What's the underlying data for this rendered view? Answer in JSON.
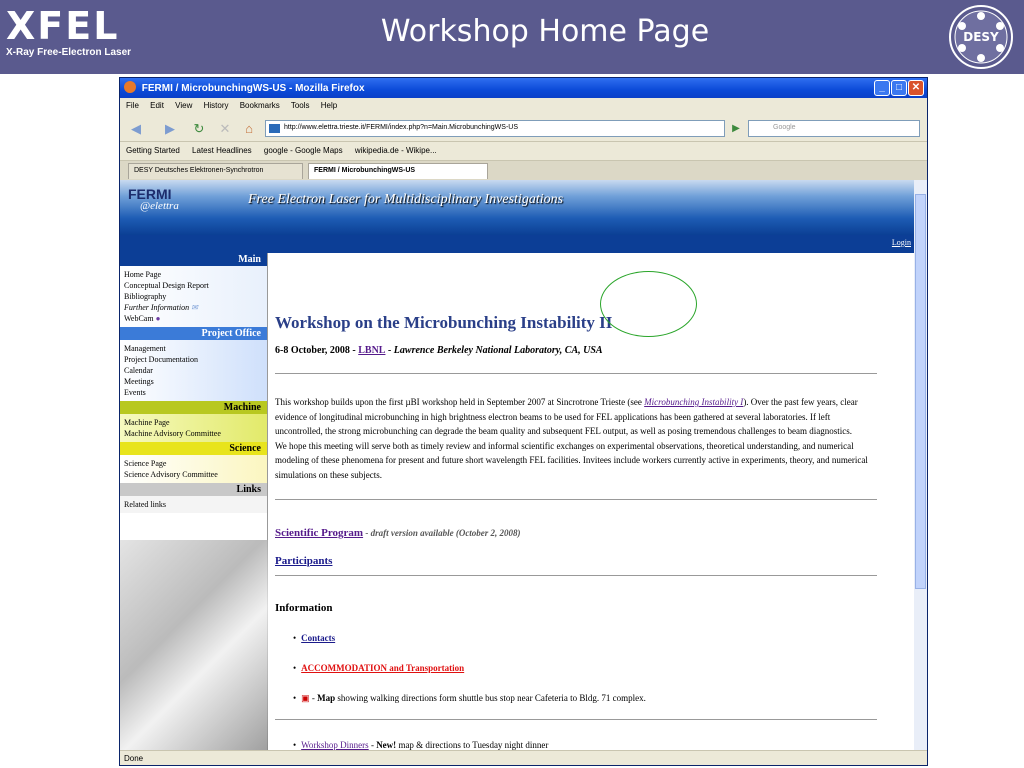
{
  "slide": {
    "title": "Workshop Home Page",
    "xfel": "XFEL",
    "xfel_sub": "X-Ray Free-Electron Laser",
    "desy": "DESY"
  },
  "browser": {
    "window_title": "FERMI / MicrobunchingWS-US - Mozilla Firefox",
    "menu": [
      "File",
      "Edit",
      "View",
      "History",
      "Bookmarks",
      "Tools",
      "Help"
    ],
    "url": "http://www.elettra.trieste.it/FERMI/index.php?n=Main.MicrobunchingWS-US",
    "search_placeholder": "Google",
    "bookmarks": [
      "Getting Started",
      "Latest Headlines",
      "google - Google Maps",
      "wikipedia.de - Wikipe..."
    ],
    "tabs": [
      "DESY Deutsches Elektronen-Synchrotron",
      "FERMI / MicrobunchingWS-US"
    ],
    "status": "Done"
  },
  "site": {
    "logo_fermi": "FERMI",
    "logo_elettra": "@elettra",
    "tagline": "Free Electron Laser for Multidisciplinary Investigations",
    "login": "Login"
  },
  "sidebar": {
    "main_title": "Main",
    "main_items": [
      "Home Page",
      "Conceptual Design Report",
      "Bibliography",
      "Further Information",
      "WebCam"
    ],
    "po_title": "Project Office",
    "po_items": [
      "Management",
      "Project Documentation",
      "Calendar",
      "Meetings",
      "Events"
    ],
    "machine_title": "Machine",
    "machine_items": [
      "Machine Page",
      "Machine Advisory Committee"
    ],
    "science_title": "Science",
    "science_items": [
      "Science Page",
      "Science Advisory Committee"
    ],
    "links_title": "Links",
    "links_items": [
      "Related links"
    ]
  },
  "content": {
    "title": "Workshop on the Microbunching Instability II",
    "date": "6-8 October, 2008 - ",
    "lbnl": "LBNL",
    "lab": " - Lawrence Berkeley National Laboratory, CA, USA",
    "para1a": "This workshop builds upon the first µBI workshop held in September 2007 at Sincrotrone Trieste (see ",
    "para1_link": "Microbunching Instability I",
    "para1b": "). Over the past few years, clear evidence of longitudinal microbunching in high brightness electron beams to be used for FEL applications has been gathered at several laboratories. If left uncontrolled, the strong microbunching can degrade the beam quality and subsequent FEL output, as well as posing tremendous challenges to beam diagnostics.",
    "para2": "We hope this meeting will serve both as timely review and informal scientific exchanges on experimental observations, theoretical understanding, and numerical modeling of these phenomena for present and future short wavelength FEL facilities. Invitees include workers currently active in experiments, theory, and numerical simulations on these subjects.",
    "program": "Scientific Program",
    "program_note": " - draft version available (October 2, 2008)",
    "participants": "Participants",
    "information": "Information",
    "contacts": "Contacts",
    "accommodation": "ACCOMMODATION and Transportation",
    "map_bold": "Map",
    "map_text": " showing walking directions form shuttle bus stop near Cafeteria to Bldg. 71 complex.",
    "dinners": "Workshop Dinners",
    "new": "New!",
    "dinners_text": " map & directions to Tuesday night dinner"
  }
}
